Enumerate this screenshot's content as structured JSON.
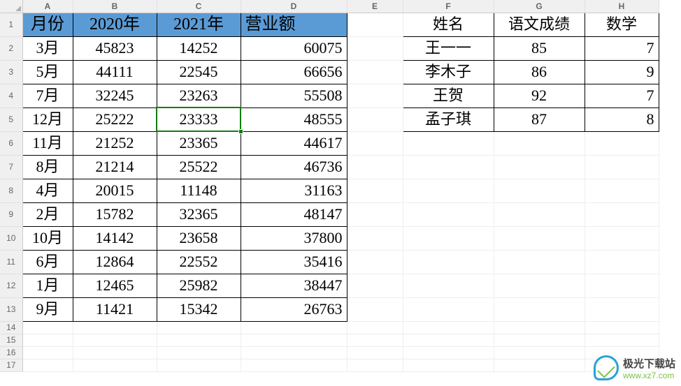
{
  "columns": [
    "A",
    "B",
    "C",
    "D",
    "E",
    "F",
    "G",
    "H"
  ],
  "col_classes": [
    "cA",
    "cB",
    "cC",
    "cD",
    "cE",
    "cF",
    "cG",
    "cH"
  ],
  "rows_visible": 17,
  "headers1": {
    "A": "月份",
    "B": "2020年",
    "C": "2021年",
    "D": "营业额"
  },
  "headers2": {
    "F": "姓名",
    "G": "语文成绩",
    "H": "数学"
  },
  "table1": [
    {
      "A": "3月",
      "B": "45823",
      "C": "14252",
      "D": "60075"
    },
    {
      "A": "5月",
      "B": "44111",
      "C": "22545",
      "D": "66656"
    },
    {
      "A": "7月",
      "B": "32245",
      "C": "23263",
      "D": "55508"
    },
    {
      "A": "12月",
      "B": "25222",
      "C": "23333",
      "D": "48555"
    },
    {
      "A": "11月",
      "B": "21252",
      "C": "23365",
      "D": "44617"
    },
    {
      "A": "8月",
      "B": "21214",
      "C": "25522",
      "D": "46736"
    },
    {
      "A": "4月",
      "B": "20015",
      "C": "11148",
      "D": "31163"
    },
    {
      "A": "2月",
      "B": "15782",
      "C": "32365",
      "D": "48147"
    },
    {
      "A": "10月",
      "B": "14142",
      "C": "23658",
      "D": "37800"
    },
    {
      "A": "6月",
      "B": "12864",
      "C": "22552",
      "D": "35416"
    },
    {
      "A": "1月",
      "B": "12465",
      "C": "25982",
      "D": "38447"
    },
    {
      "A": "9月",
      "B": "11421",
      "C": "15342",
      "D": "26763"
    }
  ],
  "table2": [
    {
      "F": "王一一",
      "G": "85",
      "H": "7"
    },
    {
      "F": "李木子",
      "G": "86",
      "H": "9"
    },
    {
      "F": "王贺",
      "G": "92",
      "H": "7"
    },
    {
      "F": "孟子琪",
      "G": "87",
      "H": "8"
    }
  ],
  "selected_cell": "C5",
  "watermark": {
    "line1": "极光下载站",
    "line2": "www.xz7.com"
  }
}
